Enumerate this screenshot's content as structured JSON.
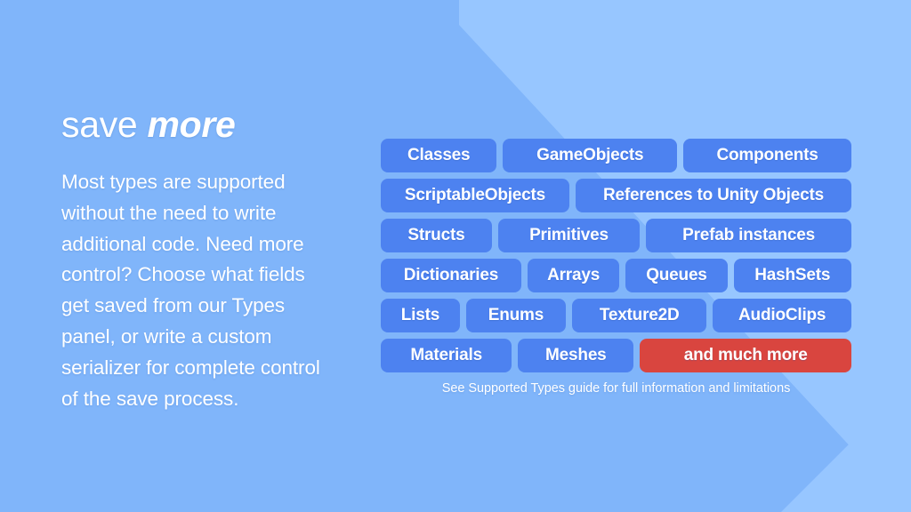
{
  "background": {
    "base_color": "#80b5fa",
    "wedge_color": "#97c6ff"
  },
  "left": {
    "headline_regular": "save ",
    "headline_accent": "more",
    "body": "Most types are supported without the need to write additional code. Need more control? Choose what fields get saved from our Types panel, or write a custom serializer for complete control of the save process."
  },
  "types": {
    "pill_color": "#4d82f0",
    "highlight_color": "#d9453f",
    "caption": "See Supported Types guide for full information and limitations",
    "rows": [
      [
        {
          "label": "Classes",
          "highlight": false,
          "grow": 1.08
        },
        {
          "label": "GameObjects",
          "highlight": false,
          "grow": 1.6
        },
        {
          "label": "Components",
          "highlight": false,
          "grow": 1.58
        }
      ],
      [
        {
          "label": "ScriptableObjects",
          "highlight": false,
          "grow": 1.83
        },
        {
          "label": "References to Unity Objects",
          "highlight": false,
          "grow": 2.42
        }
      ],
      [
        {
          "label": "Structs",
          "highlight": false,
          "grow": 1.08
        },
        {
          "label": "Primitives",
          "highlight": false,
          "grow": 1.4
        },
        {
          "label": "Prefab instances",
          "highlight": false,
          "grow": 1.78
        }
      ],
      [
        {
          "label": "Dictionaries",
          "highlight": false,
          "grow": 1.35
        },
        {
          "label": "Arrays",
          "highlight": false,
          "grow": 0.95
        },
        {
          "label": "Queues",
          "highlight": false,
          "grow": 1.02
        },
        {
          "label": "HashSets",
          "highlight": false,
          "grow": 1.12
        }
      ],
      [
        {
          "label": "Lists",
          "highlight": false,
          "grow": 0.74
        },
        {
          "label": "Enums",
          "highlight": false,
          "grow": 0.92
        },
        {
          "label": "Texture2D",
          "highlight": false,
          "grow": 1.42
        },
        {
          "label": "AudioClips",
          "highlight": false,
          "grow": 1.24
        }
      ],
      [
        {
          "label": "Materials",
          "highlight": false,
          "grow": 1.16
        },
        {
          "label": "Meshes",
          "highlight": false,
          "grow": 1.0
        },
        {
          "label": "and much more",
          "highlight": true,
          "grow": 2.12
        }
      ]
    ]
  }
}
